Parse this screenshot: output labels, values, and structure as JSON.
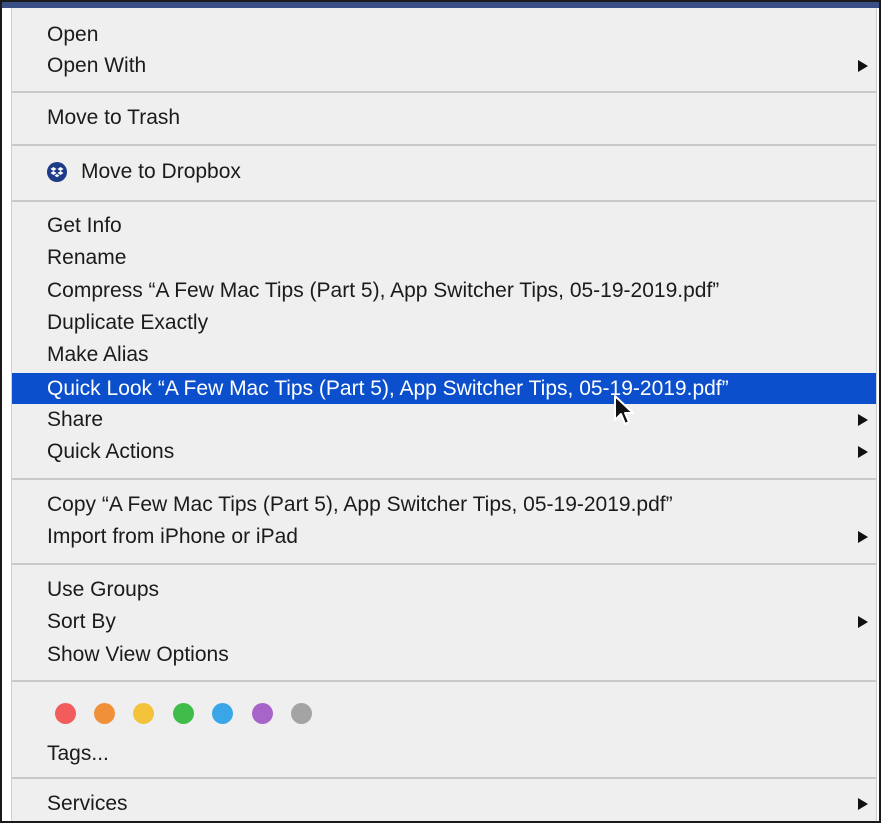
{
  "menu": {
    "open": "Open",
    "open_with": "Open With",
    "move_to_trash": "Move to Trash",
    "move_to_dropbox": "Move to Dropbox",
    "get_info": "Get Info",
    "rename": "Rename",
    "compress": "Compress “A Few Mac Tips (Part 5), App Switcher Tips, 05-19-2019.pdf”",
    "duplicate_exactly": "Duplicate Exactly",
    "make_alias": "Make Alias",
    "quick_look": "Quick Look “A Few Mac Tips (Part 5), App Switcher Tips, 05-19-2019.pdf”",
    "share": "Share",
    "quick_actions": "Quick Actions",
    "copy": "Copy “A Few Mac Tips (Part 5), App Switcher Tips, 05-19-2019.pdf”",
    "import_from_iphone": "Import from iPhone or iPad",
    "use_groups": "Use Groups",
    "sort_by": "Sort By",
    "show_view_options": "Show View Options",
    "tags": "Tags...",
    "services": "Services"
  },
  "highlighted_item": "quick_look",
  "tag_colors": [
    {
      "name": "red",
      "color": "#f25c5c"
    },
    {
      "name": "orange",
      "color": "#f0913a"
    },
    {
      "name": "yellow",
      "color": "#f5c23b"
    },
    {
      "name": "green",
      "color": "#3fbc4a"
    },
    {
      "name": "blue",
      "color": "#3aa6e8"
    },
    {
      "name": "purple",
      "color": "#a865c9"
    },
    {
      "name": "gray",
      "color": "#a4a4a4"
    }
  ],
  "colors": {
    "highlight": "#0b4fcc",
    "menu_background": "#efefef",
    "dropbox_icon": "#1d3b86"
  }
}
